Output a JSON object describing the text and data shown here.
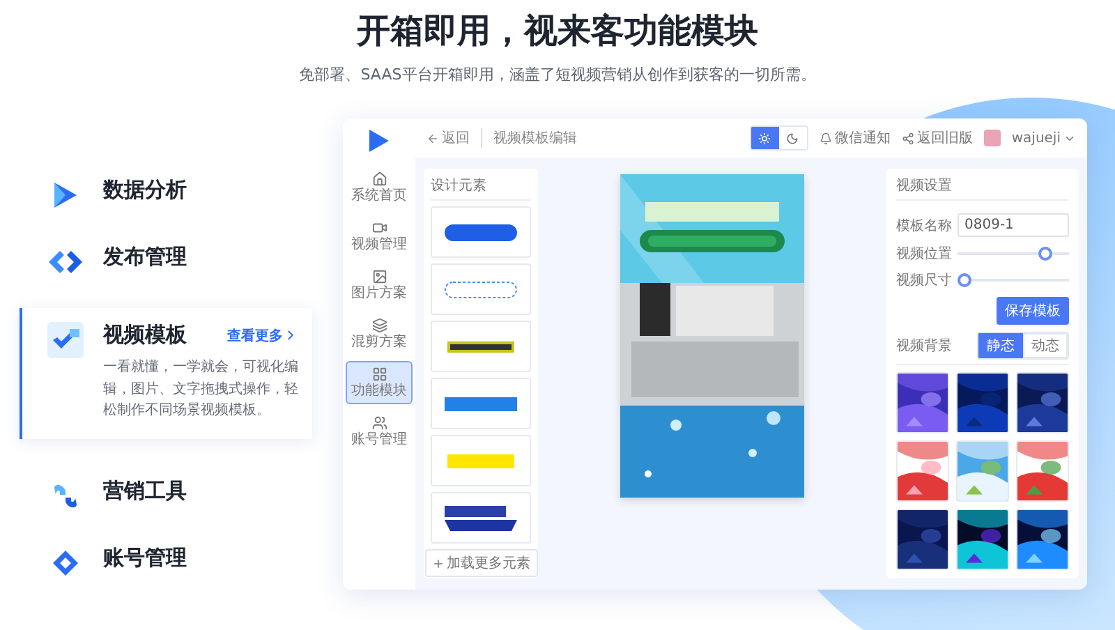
{
  "header": {
    "title": "开箱即用，视来客功能模块",
    "subtitle": "免部署、SAAS平台开箱即用，涵盖了短视频营销从创作到获客的一切所需。"
  },
  "features": [
    {
      "label": "数据分析",
      "selected": false
    },
    {
      "label": "发布管理",
      "selected": false
    },
    {
      "label": "视频模板",
      "selected": true,
      "link": "查看更多",
      "description": "一看就懂，一学就会，可视化编辑，图片、文字拖拽式操作，轻松制作不同场景视频模板。"
    },
    {
      "label": "营销工具",
      "selected": false
    },
    {
      "label": "账号管理",
      "selected": false
    }
  ],
  "app": {
    "nav": [
      {
        "label": "系统首页",
        "selected": false
      },
      {
        "label": "视频管理",
        "selected": false
      },
      {
        "label": "图片方案",
        "selected": false
      },
      {
        "label": "混剪方案",
        "selected": false
      },
      {
        "label": "功能模块",
        "selected": true
      },
      {
        "label": "账号管理",
        "selected": false
      }
    ],
    "breadcrumb": {
      "back": "返回",
      "title": "视频模板编辑"
    },
    "toolbar": {
      "theme_modes": [
        {
          "kind": "light",
          "selected": true
        },
        {
          "kind": "dark",
          "selected": false
        }
      ],
      "notify": "微信通知",
      "old_version": "返回旧版",
      "user": "wajueji"
    },
    "elements_panel": {
      "title": "设计元素",
      "stickers": [
        {
          "kind": "pill"
        },
        {
          "kind": "dashed"
        },
        {
          "kind": "plain"
        },
        {
          "kind": "bluebar"
        },
        {
          "kind": "yellowbar"
        },
        {
          "kind": "banner"
        }
      ],
      "load_more": "加载更多元素"
    },
    "settings": {
      "title": "视频设置",
      "name_label": "模板名称",
      "name_value": "0809-1",
      "sliders": [
        {
          "label": "视频位置",
          "level": 0.85
        },
        {
          "label": "视频尺寸",
          "level": 0
        }
      ],
      "save": "保存模板",
      "bg_title": "视频背景",
      "bg_tabs": [
        {
          "label": "静态",
          "selected": true
        },
        {
          "label": "动态",
          "selected": false
        }
      ],
      "backgrounds": [
        {
          "kind": "violet"
        },
        {
          "kind": "navy"
        },
        {
          "kind": "night"
        },
        {
          "kind": "redsplash"
        },
        {
          "kind": "sky"
        },
        {
          "kind": "colorsplash"
        },
        {
          "kind": "deep"
        },
        {
          "kind": "tech"
        },
        {
          "kind": "arc"
        }
      ]
    }
  }
}
